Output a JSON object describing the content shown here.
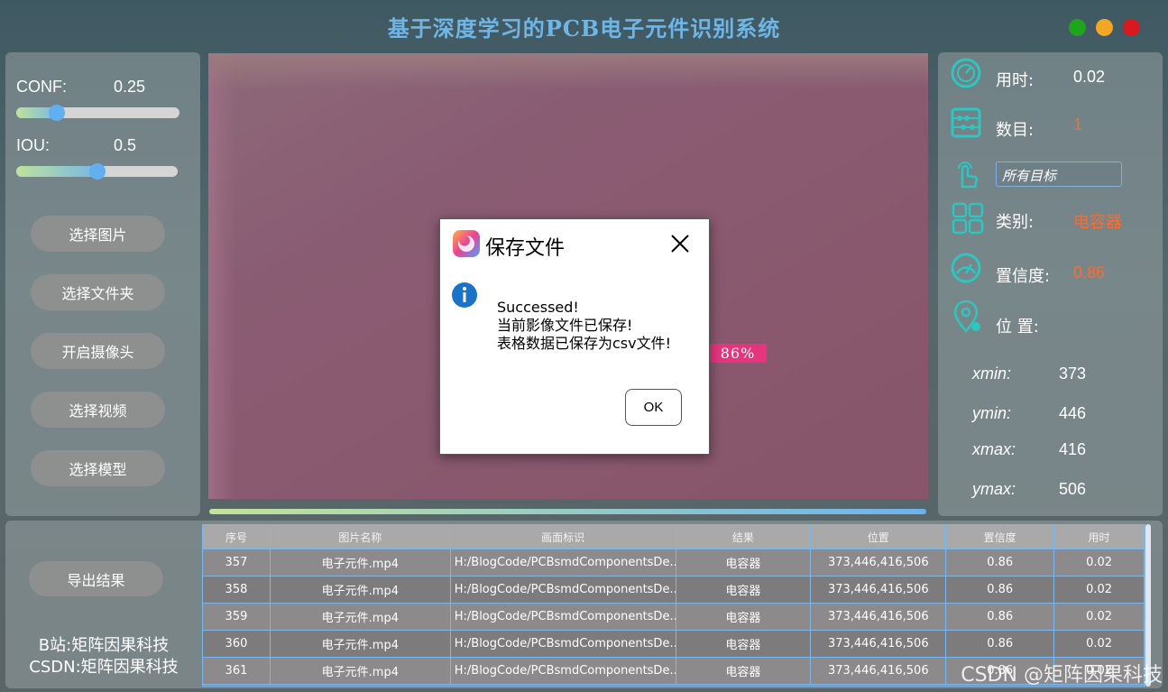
{
  "app": {
    "title": "基于深度学习的PCB电子元件识别系统"
  },
  "window_controls": {
    "colors": [
      "#1ea51b",
      "#f5a623",
      "#d9181f"
    ]
  },
  "params": {
    "conf": {
      "label": "CONF:",
      "value": "0.25",
      "fraction": 0.25
    },
    "iou": {
      "label": "IOU:",
      "value": "0.5",
      "fraction": 0.5
    }
  },
  "buttons": {
    "select_image": "选择图片",
    "select_folder": "选择文件夹",
    "open_camera": "开启摄像头",
    "select_video": "选择视频",
    "select_model": "选择模型",
    "export": "导出结果"
  },
  "detection": {
    "label": "86%"
  },
  "info": {
    "time_label": "用时:",
    "time_value": "0.02",
    "count_label": "数目:",
    "count_value": "1",
    "target_select": "所有目标",
    "class_label": "类别:",
    "class_value": "电容器",
    "conf_label": "置信度:",
    "conf_value": "0.86",
    "pos_label": "位 置:",
    "xmin_label": "xmin:",
    "xmin": "373",
    "ymin_label": "ymin:",
    "ymin": "446",
    "xmax_label": "xmax:",
    "xmax": "416",
    "ymax_label": "ymax:",
    "ymax": "506"
  },
  "table": {
    "headers": [
      "序号",
      "图片名称",
      "画面标识",
      "结果",
      "位置",
      "置信度",
      "用时"
    ],
    "rows": [
      [
        "357",
        "电子元件.mp4",
        "H:/BlogCode/PCBsmdComponentsDe...",
        "电容器",
        "373,446,416,506",
        "0.86",
        "0.02"
      ],
      [
        "358",
        "电子元件.mp4",
        "H:/BlogCode/PCBsmdComponentsDe...",
        "电容器",
        "373,446,416,506",
        "0.86",
        "0.02"
      ],
      [
        "359",
        "电子元件.mp4",
        "H:/BlogCode/PCBsmdComponentsDe...",
        "电容器",
        "373,446,416,506",
        "0.86",
        "0.02"
      ],
      [
        "360",
        "电子元件.mp4",
        "H:/BlogCode/PCBsmdComponentsDe...",
        "电容器",
        "373,446,416,506",
        "0.86",
        "0.02"
      ],
      [
        "361",
        "电子元件.mp4",
        "H:/BlogCode/PCBsmdComponentsDe...",
        "电容器",
        "373,446,416,506",
        "0.86",
        "0.02"
      ]
    ]
  },
  "footer": {
    "bilibili": "B站:矩阵因果科技",
    "csdn": "CSDN:矩阵因果科技",
    "watermark": "CSDN @矩阵因果科技"
  },
  "dialog": {
    "title": "保存文件",
    "line1": "Successed!",
    "line2": "当前影像文件已保存!",
    "line3": "表格数据已保存为csv文件!",
    "ok": "OK"
  },
  "colors": {
    "accent_orange": "#ff6b2b",
    "icon_teal": "#2ec6c0",
    "title_blue": "#6fb6e8"
  }
}
